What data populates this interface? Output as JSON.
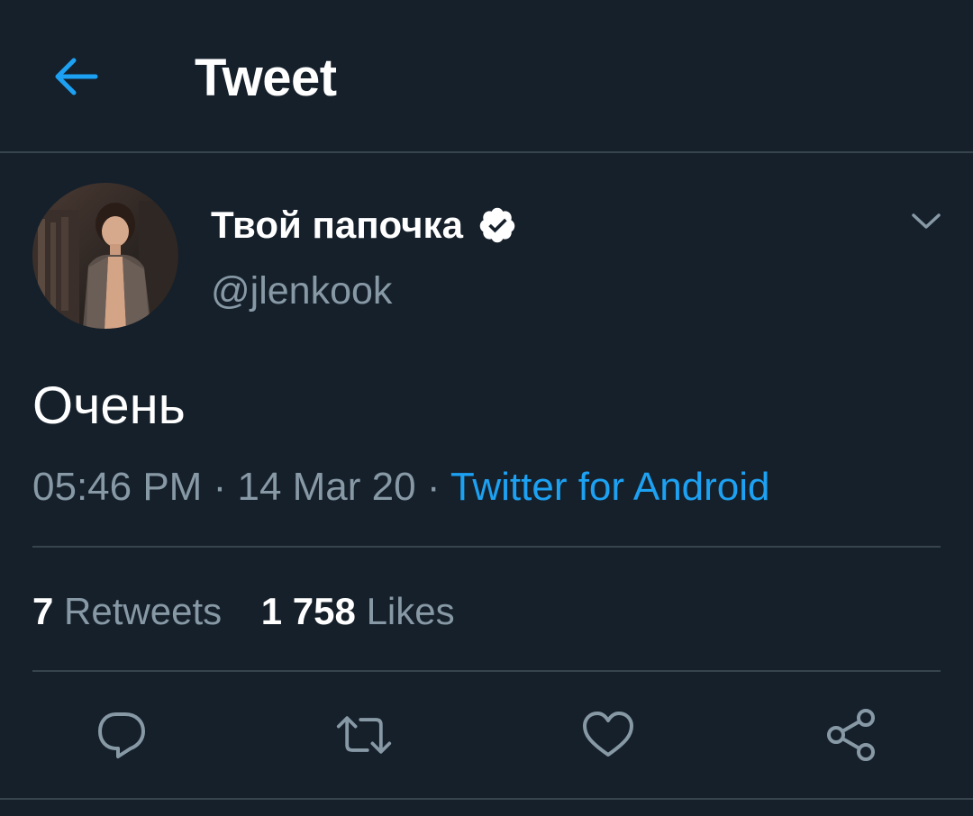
{
  "header": {
    "title": "Tweet",
    "back_icon": "back-arrow-icon"
  },
  "tweet": {
    "author": {
      "name": "Твой папочка",
      "handle": "@jlenkook",
      "verified": true
    },
    "text": "Очень",
    "time": "05:46 PM",
    "date": "14 Mar 20",
    "separator": "·",
    "source": "Twitter for Android",
    "stats": {
      "retweets_count": "7",
      "retweets_label": "Retweets",
      "likes_count": "1 758",
      "likes_label": "Likes"
    },
    "actions": [
      "reply-icon",
      "retweet-icon",
      "like-icon",
      "share-icon"
    ]
  },
  "colors": {
    "background": "#15202b",
    "accent": "#1da1f2",
    "secondary_text": "#8899a6",
    "divider": "#38444d"
  }
}
